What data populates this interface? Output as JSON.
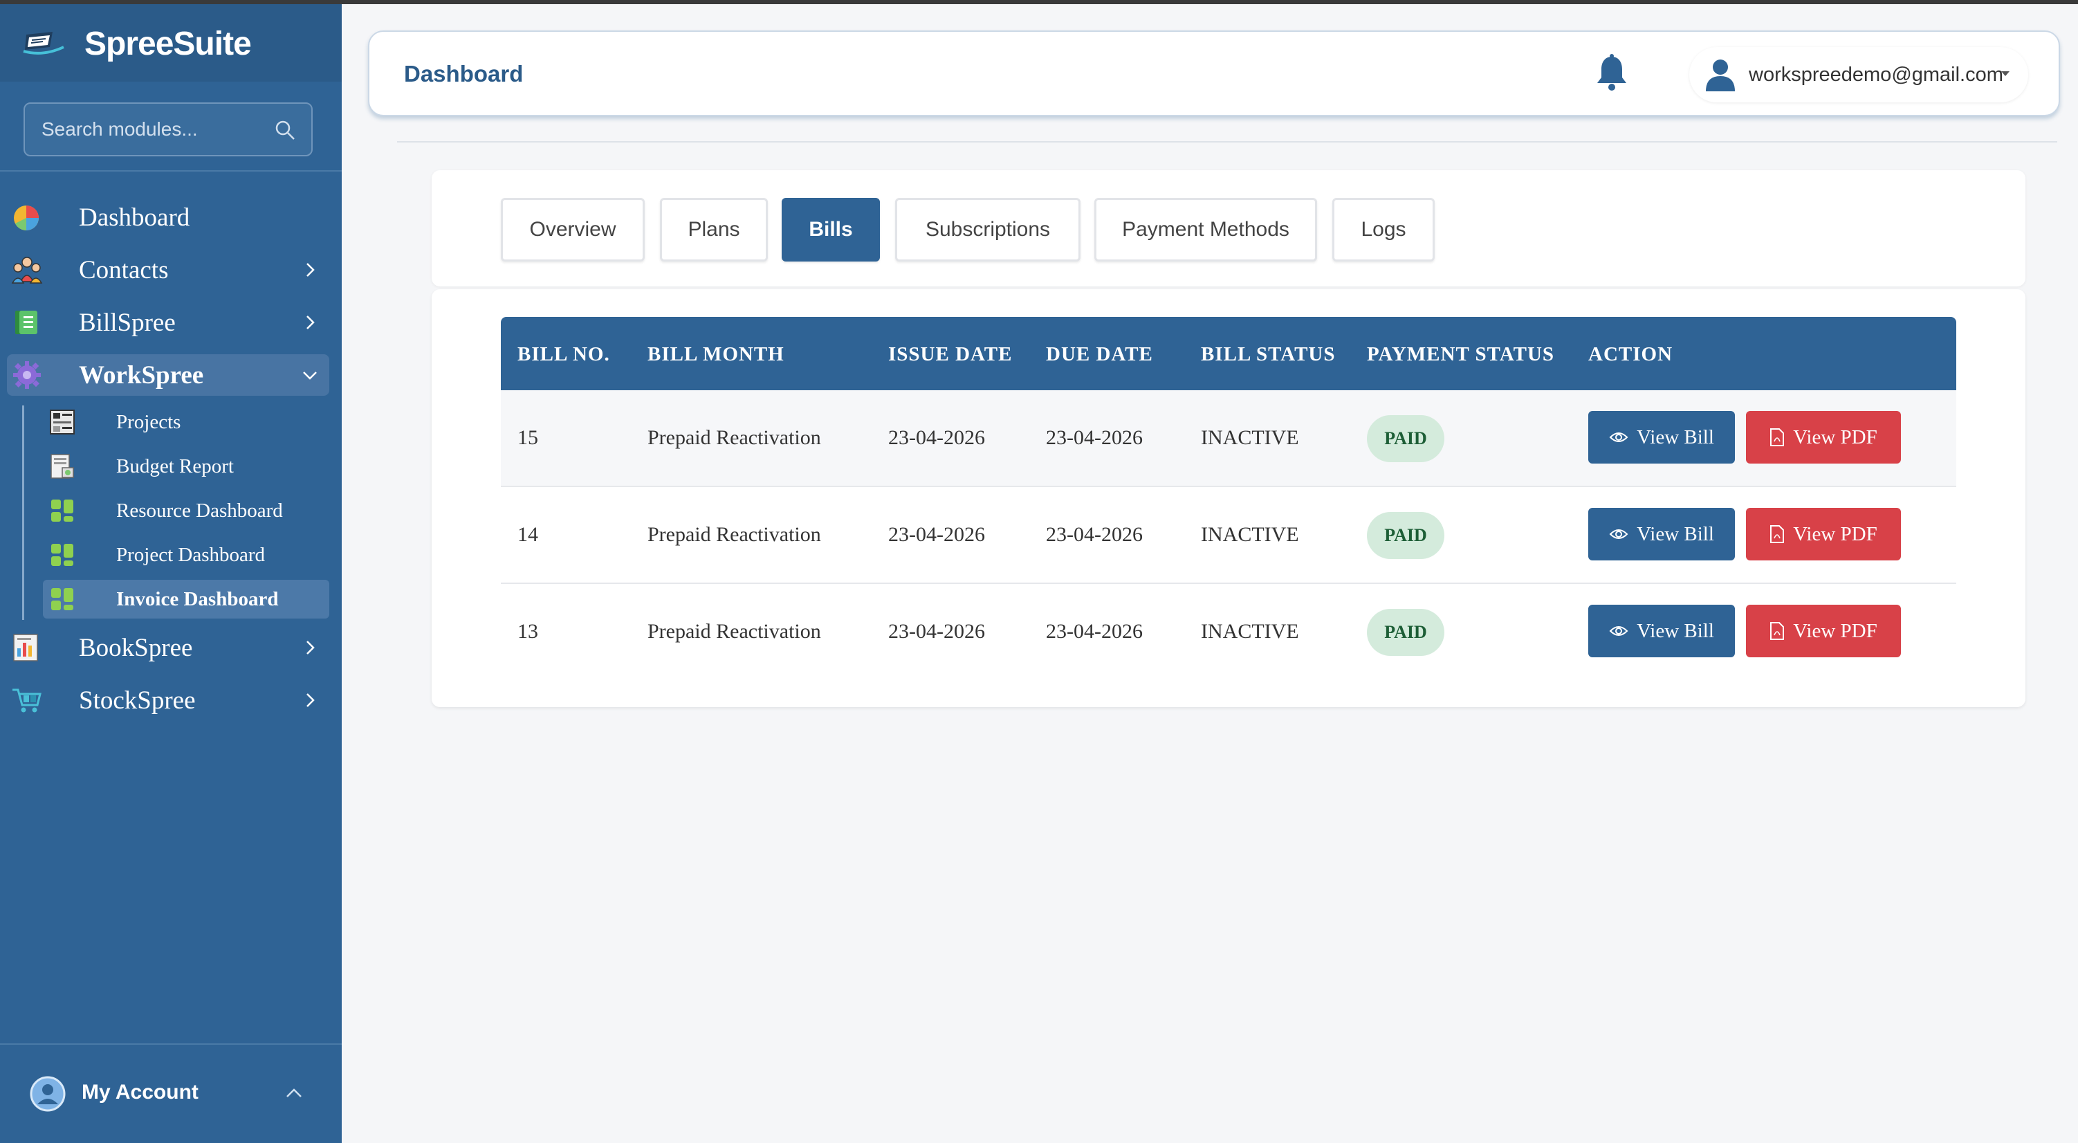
{
  "brand": {
    "name": "SpreeSuite"
  },
  "search": {
    "placeholder": "Search modules..."
  },
  "sidebar": {
    "items": [
      {
        "label": "Dashboard",
        "icon": "pie-chart-icon"
      },
      {
        "label": "Contacts",
        "icon": "people-icon"
      },
      {
        "label": "BillSpree",
        "icon": "document-icon"
      },
      {
        "label": "WorkSpree",
        "icon": "gear-icon"
      },
      {
        "label": "BookSpree",
        "icon": "report-icon"
      },
      {
        "label": "StockSpree",
        "icon": "cart-icon"
      }
    ],
    "workspree_sub": [
      {
        "label": "Projects"
      },
      {
        "label": "Budget Report"
      },
      {
        "label": "Resource Dashboard"
      },
      {
        "label": "Project Dashboard"
      },
      {
        "label": "Invoice Dashboard"
      }
    ],
    "account_label": "My Account"
  },
  "header": {
    "title": "Dashboard",
    "user_email": "workspreedemo@gmail.com"
  },
  "tabs": [
    "Overview",
    "Plans",
    "Bills",
    "Subscriptions",
    "Payment Methods",
    "Logs"
  ],
  "active_tab": "Bills",
  "table": {
    "columns": [
      "BILL NO.",
      "BILL MONTH",
      "ISSUE DATE",
      "DUE DATE",
      "BILL STATUS",
      "PAYMENT STATUS",
      "ACTION"
    ],
    "rows": [
      {
        "bill_no": "15",
        "bill_month": "Prepaid Reactivation",
        "issue_date": "23-04-2026",
        "due_date": "23-04-2026",
        "bill_status": "INACTIVE",
        "payment_status": "PAID"
      },
      {
        "bill_no": "14",
        "bill_month": "Prepaid Reactivation",
        "issue_date": "23-04-2026",
        "due_date": "23-04-2026",
        "bill_status": "INACTIVE",
        "payment_status": "PAID"
      },
      {
        "bill_no": "13",
        "bill_month": "Prepaid Reactivation",
        "issue_date": "23-04-2026",
        "due_date": "23-04-2026",
        "bill_status": "INACTIVE",
        "payment_status": "PAID"
      }
    ],
    "view_bill_label": "View Bill",
    "view_pdf_label": "View PDF"
  },
  "colors": {
    "sidebar_bg": "#2f6395",
    "primary": "#2f6395",
    "danger": "#d84148",
    "paid_badge_bg": "#d4ebdc",
    "paid_badge_text": "#1d5e36"
  }
}
